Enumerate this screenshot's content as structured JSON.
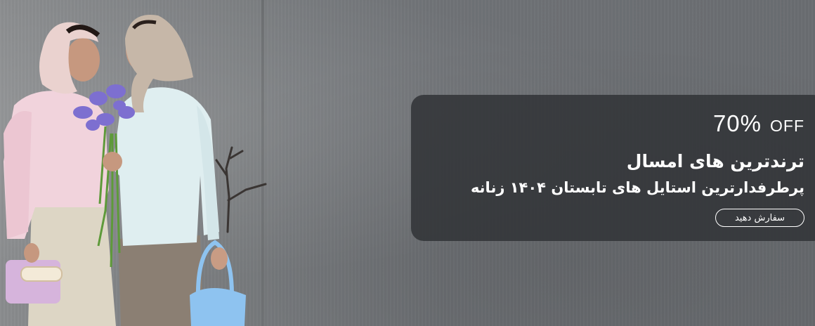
{
  "banner": {
    "discount": {
      "value": "70%",
      "label": "OFF"
    },
    "headline": "ترندترین های امسال",
    "subheadline": "پرطرفدارترین استایل های تابستان ۱۴۰۴ زنانه",
    "cta_label": "سفارش دهید"
  },
  "colors": {
    "panel_bg": "#323438",
    "wall": "#7b7e81",
    "text": "#ffffff",
    "pink_shirt": "#f1d3dc",
    "mint_shirt": "#dfeef0",
    "iris": "#7d6fd0",
    "blue_bag": "#8ec3f0",
    "lilac_bag": "#d6b4dc"
  },
  "icons": [
    "iris-bouquet",
    "branch",
    "handbag"
  ]
}
